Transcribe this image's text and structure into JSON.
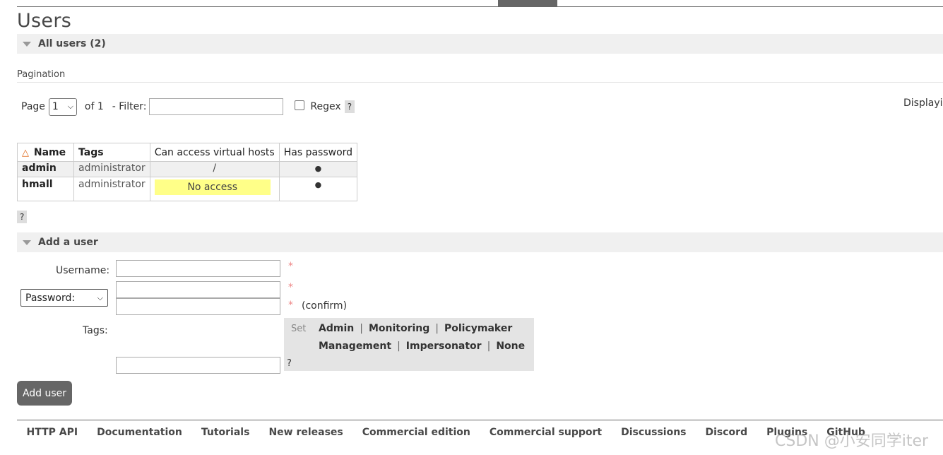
{
  "page": {
    "title": "Users"
  },
  "all_users": {
    "header": "All users (2)"
  },
  "pagination": {
    "label": "Pagination",
    "page_label": "Page",
    "page_value": "1",
    "of_text": "of 1",
    "filter_label": "- Filter:",
    "filter_value": "",
    "regex_label": "Regex",
    "help": "?",
    "displaying": "Displayir"
  },
  "table": {
    "headers": {
      "name": "Name",
      "tags": "Tags",
      "vhosts": "Can access virtual hosts",
      "password": "Has password"
    },
    "rows": [
      {
        "name": "admin",
        "tags": "administrator",
        "vhosts": "/",
        "password": "●"
      },
      {
        "name": "hmall",
        "tags": "administrator",
        "vhosts": "No access",
        "password": "●"
      }
    ],
    "help": "?"
  },
  "add_user": {
    "header": "Add a user",
    "username_label": "Username:",
    "password_select": "Password:",
    "confirm_label": "(confirm)",
    "required_mark": "*",
    "tags_label": "Tags:",
    "tags_set_label": "Set",
    "tag_options_line1": [
      "Admin",
      "Monitoring",
      "Policymaker"
    ],
    "tag_options_line2": [
      "Management",
      "Impersonator",
      "None"
    ],
    "separator": "|",
    "tags_help": "?",
    "submit_label": "Add user"
  },
  "footer": {
    "links": [
      "HTTP API",
      "Documentation",
      "Tutorials",
      "New releases",
      "Commercial edition",
      "Commercial support",
      "Discussions",
      "Discord",
      "Plugins",
      "GitHub"
    ]
  },
  "watermark": "CSDN @小安同学iter",
  "colors": {
    "no_access_bg": "#ffff88",
    "sort_indicator": "#e06a1b",
    "button_bg": "#666666"
  }
}
